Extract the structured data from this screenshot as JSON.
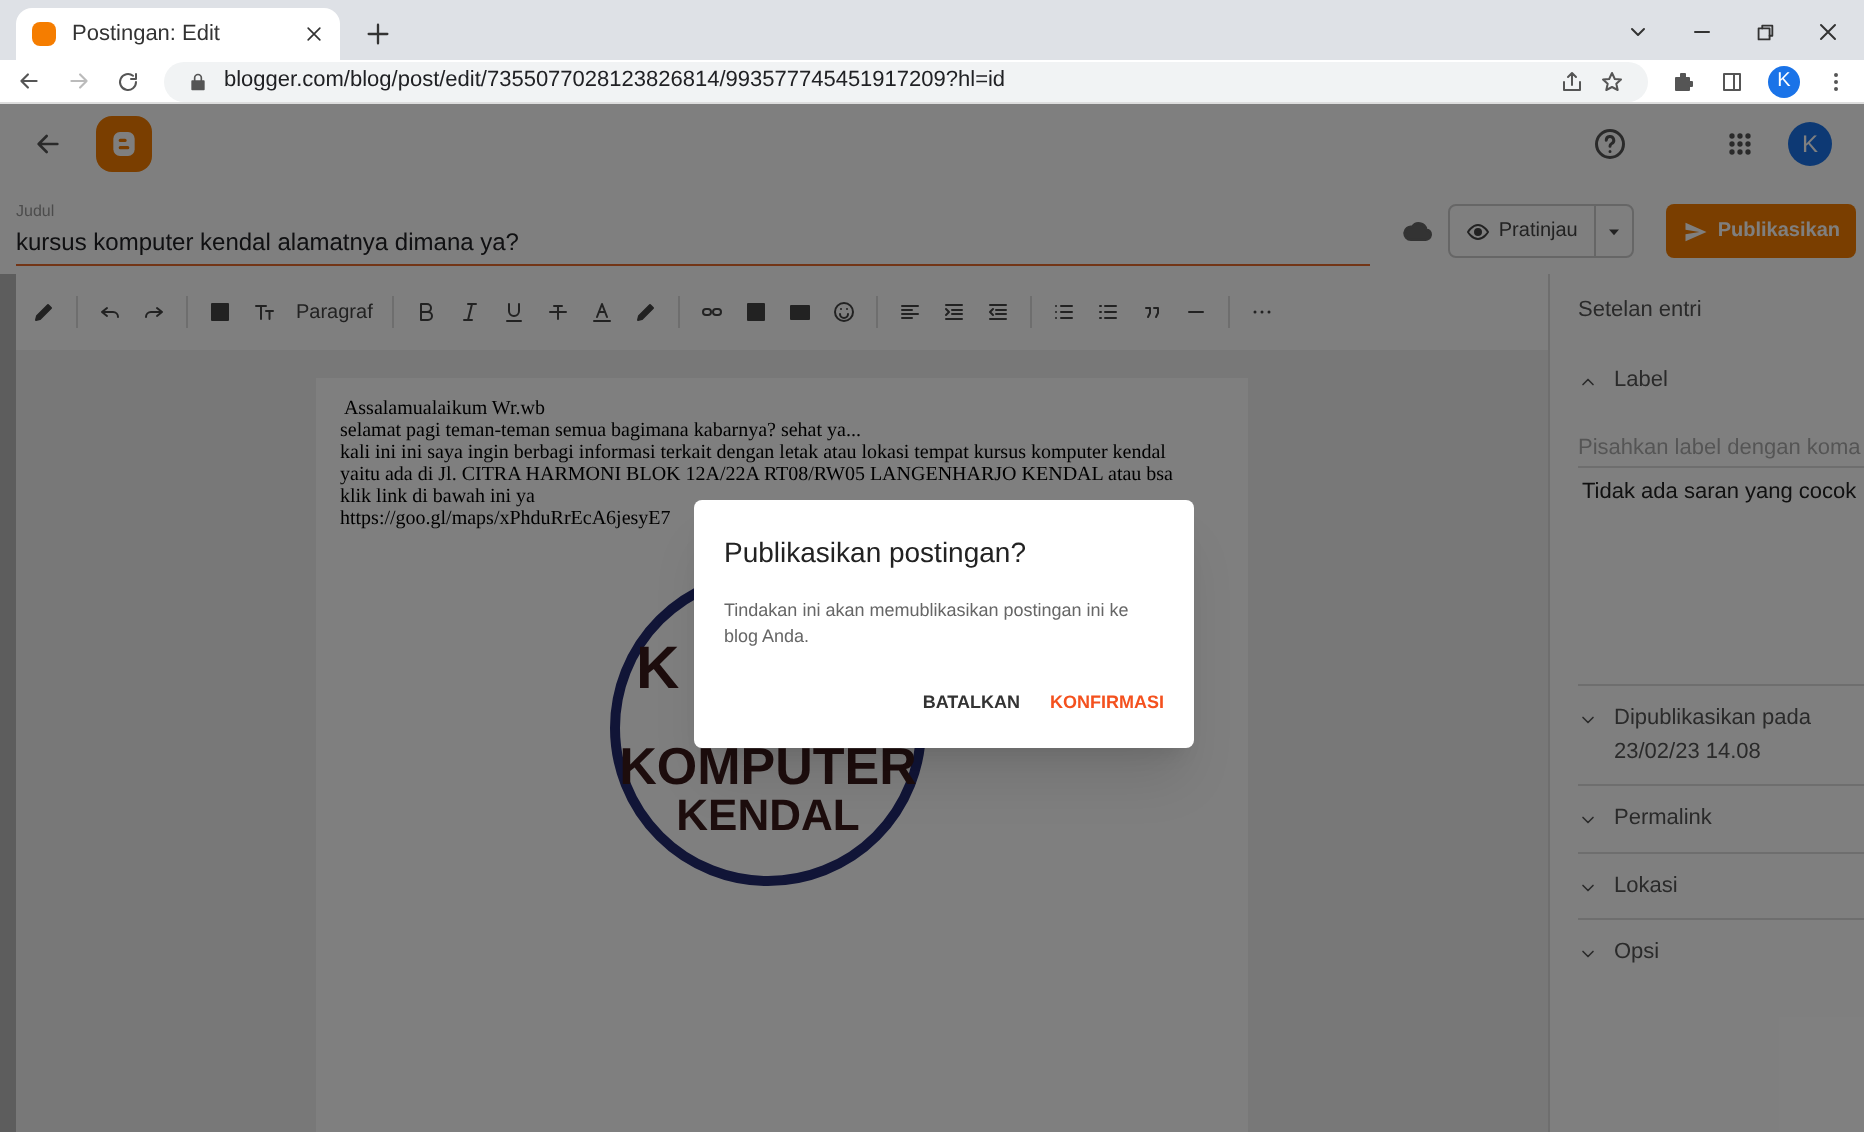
{
  "browser": {
    "tab_title": "Postingan: Edit",
    "url": "blogger.com/blog/post/edit/7355077028123826814/993577745451917209?hl=id",
    "avatar": "K"
  },
  "header": {
    "avatar": "K"
  },
  "title_field": {
    "label": "Judul",
    "value": "kursus komputer kendal alamatnya dimana ya?"
  },
  "actions": {
    "preview": "Pratinjau",
    "publish": "Publikasikan"
  },
  "toolbar": {
    "paragraph": "Paragraf"
  },
  "post": {
    "lines": [
      " Assalamualaikum Wr.wb",
      "selamat pagi teman-teman semua bagimana kabarnya? sehat ya...",
      "kali ini ini saya ingin berbagi informasi terkait dengan letak atau lokasi tempat kursus komputer kendal",
      "yaitu ada di Jl. CITRA HARMONI BLOK 12A/22A RT08/RW05 LANGENHARJO KENDAL atau bsa",
      "klik link di bawah ini ya",
      "https://goo.gl/maps/xPhduRrEcA6jesyE7"
    ],
    "logo_texts": [
      "K",
      "KOMPUTER",
      "KENDAL"
    ]
  },
  "sidebar": {
    "title": "Setelan entri",
    "sections": [
      {
        "label": "Label",
        "expanded": true,
        "placeholder": "Pisahkan label dengan koma",
        "note": "Tidak ada saran yang cocok"
      },
      {
        "label": "Dipublikasikan pada",
        "detail": "23/02/23 14.08",
        "expanded": false
      },
      {
        "label": "Permalink",
        "expanded": false
      },
      {
        "label": "Lokasi",
        "expanded": false
      },
      {
        "label": "Opsi",
        "expanded": false
      }
    ]
  },
  "dialog": {
    "title": "Publikasikan postingan?",
    "message": "Tindakan ini akan memublikasikan postingan ini ke blog Anda.",
    "buttons": [
      {
        "label": "BATALKAN",
        "kind": "cancel"
      },
      {
        "label": "KONFIRMASI",
        "kind": "confirm"
      }
    ]
  }
}
